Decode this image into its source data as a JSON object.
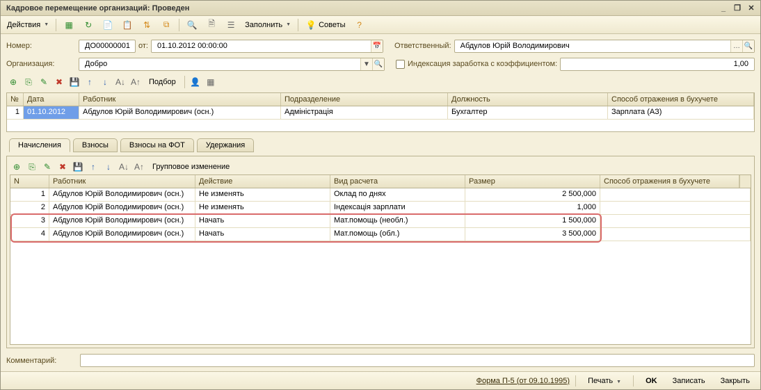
{
  "window": {
    "title": "Кадровое перемещение организаций: Проведен"
  },
  "toolbar": {
    "actions_label": "Действия",
    "fill_label": "Заполнить",
    "tips_label": "Советы"
  },
  "form": {
    "number_label": "Номер:",
    "number_value": "ДО00000001",
    "from_label": "от:",
    "date_value": "01.10.2012 00:00:00",
    "responsible_label": "Ответственный:",
    "responsible_value": "Абдулов Юрій Володимирович",
    "org_label": "Организация:",
    "org_value": "Добро",
    "indexation_label": "Индексация заработка с коэффициентом:",
    "indexation_value": "1,00"
  },
  "grid1_toolbar": {
    "pick_label": "Подбор"
  },
  "grid1": {
    "headers": {
      "n": "№",
      "date": "Дата",
      "worker": "Работник",
      "dept": "Подразделение",
      "pos": "Должность",
      "refl": "Способ отражения в бухучете"
    },
    "rows": [
      {
        "n": "1",
        "date": "01.10.2012",
        "worker": "Абдулов Юрій Володимирович (осн.)",
        "dept": "Адміністрація",
        "pos": "Бухгалтер",
        "refl": "Зарплата (АЗ)"
      }
    ]
  },
  "tabs": {
    "t1": "Начисления",
    "t2": "Взносы",
    "t3": "Взносы на ФОТ",
    "t4": "Удержания"
  },
  "grid2_toolbar": {
    "group_change_label": "Групповое изменение"
  },
  "grid2": {
    "headers": {
      "n": "N",
      "worker": "Работник",
      "action": "Действие",
      "calc": "Вид расчета",
      "size": "Размер",
      "refl": "Способ отражения в бухучете"
    },
    "rows": [
      {
        "n": "1",
        "worker": "Абдулов Юрій Володимирович (осн.)",
        "action": "Не изменять",
        "calc": "Оклад по днях",
        "size": "2 500,000",
        "refl": ""
      },
      {
        "n": "2",
        "worker": "Абдулов Юрій Володимирович (осн.)",
        "action": "Не изменять",
        "calc": "Індексація зарплати",
        "size": "1,000",
        "refl": ""
      },
      {
        "n": "3",
        "worker": "Абдулов Юрій Володимирович (осн.)",
        "action": "Начать",
        "calc": "Мат.помощь (необл.)",
        "size": "1 500,000",
        "refl": ""
      },
      {
        "n": "4",
        "worker": "Абдулов Юрій Володимирович (осн.)",
        "action": "Начать",
        "calc": "Мат.помощь (обл.)",
        "size": "3 500,000",
        "refl": ""
      }
    ]
  },
  "footer": {
    "comment_label": "Комментарий:",
    "comment_value": ""
  },
  "statusbar": {
    "form_p5": "Форма П-5 (от 09.10.1995)",
    "print": "Печать",
    "ok": "OK",
    "save": "Записать",
    "close": "Закрыть"
  }
}
